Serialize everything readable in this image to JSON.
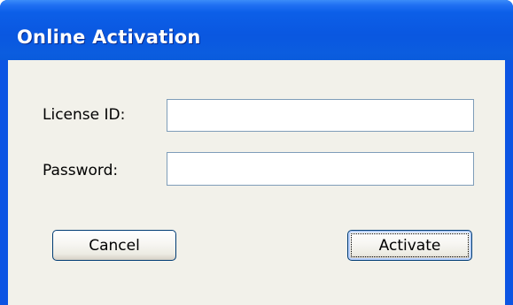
{
  "window": {
    "title": "Online Activation"
  },
  "form": {
    "license_label": "License ID:",
    "license_value": "",
    "password_label": "Password:",
    "password_value": ""
  },
  "buttons": {
    "cancel_label": "Cancel",
    "activate_label": "Activate"
  },
  "colors": {
    "titlebar": "#0a57e0",
    "client_bg": "#f2f1ea",
    "title_text": "#ffffff"
  }
}
